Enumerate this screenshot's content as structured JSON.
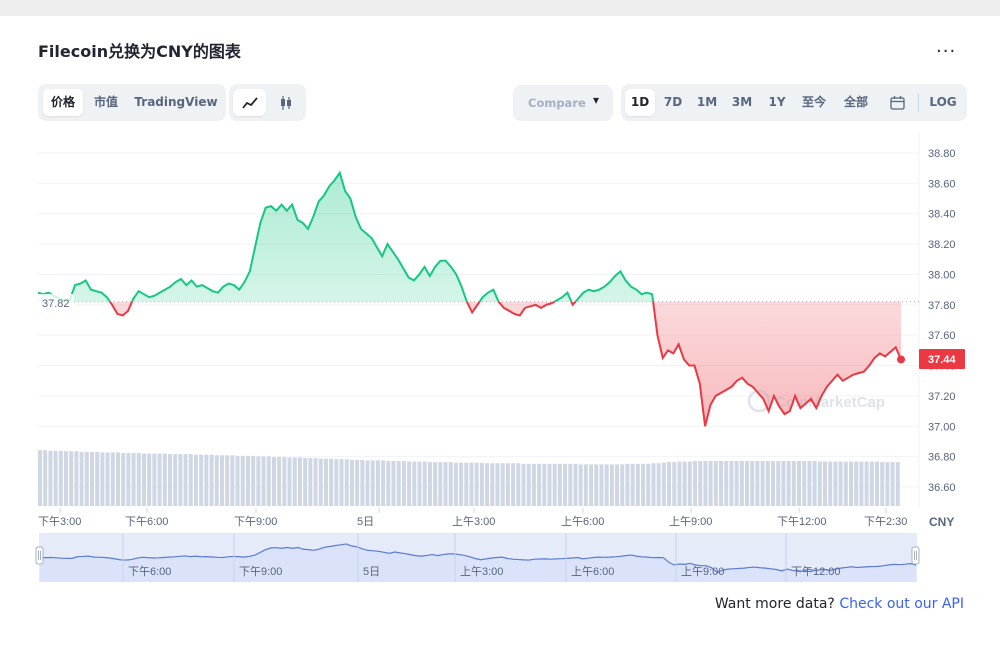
{
  "title": "Filecoin兑换为CNY的图表",
  "more_label": "...",
  "view_tabs": [
    "价格",
    "市值",
    "TradingView"
  ],
  "chart_types": [
    "line-chart-icon",
    "candlestick-icon"
  ],
  "compare_label": "Compare with",
  "ranges": [
    "1D",
    "7D",
    "1M",
    "3M",
    "1Y",
    "至今",
    "全部"
  ],
  "log_label": "LOG",
  "currency": "CNY",
  "watermark": "CoinMarketCap",
  "footer": {
    "text": "Want more data?",
    "link": "Check out our API"
  },
  "colors": {
    "up": "#16c784",
    "down": "#ea3943",
    "brand": "#3861fb"
  },
  "chart_data": {
    "type": "line",
    "reference_price": 37.82,
    "current_price": 37.44,
    "y_ticks": [
      "38.80",
      "38.60",
      "38.40",
      "38.20",
      "38.00",
      "37.80",
      "37.60",
      "37.40",
      "37.20",
      "37.00",
      "36.80",
      "36.60"
    ],
    "ylim": [
      36.5,
      38.9
    ],
    "x_ticks": [
      "下午3:00",
      "下午6:00",
      "下午9:00",
      "5日",
      "上午3:00",
      "上午6:00",
      "上午9:00",
      "下午12:00",
      "下午2:30"
    ],
    "navigator_ticks": [
      "下午6:00",
      "下午9:00",
      "5日",
      "上午3:00",
      "上午6:00",
      "上午9:00",
      "下午12:00"
    ],
    "values": [
      37.88,
      37.87,
      37.88,
      37.86,
      37.84,
      37.83,
      37.83,
      37.93,
      37.94,
      37.96,
      37.9,
      37.89,
      37.88,
      37.85,
      37.8,
      37.74,
      37.73,
      37.76,
      37.84,
      37.89,
      37.87,
      37.85,
      37.86,
      37.88,
      37.9,
      37.92,
      37.95,
      37.97,
      37.93,
      37.96,
      37.92,
      37.93,
      37.91,
      37.89,
      37.88,
      37.92,
      37.94,
      37.93,
      37.9,
      37.95,
      38.02,
      38.18,
      38.34,
      38.44,
      38.45,
      38.42,
      38.46,
      38.42,
      38.46,
      38.36,
      38.34,
      38.3,
      38.38,
      38.48,
      38.52,
      38.58,
      38.62,
      38.67,
      38.55,
      38.5,
      38.38,
      38.3,
      38.27,
      38.24,
      38.18,
      38.12,
      38.2,
      38.15,
      38.1,
      38.04,
      37.98,
      37.96,
      38.0,
      38.05,
      37.99,
      38.05,
      38.09,
      38.09,
      38.05,
      38.0,
      37.92,
      37.82,
      37.75,
      37.8,
      37.85,
      37.88,
      37.9,
      37.82,
      37.78,
      37.76,
      37.74,
      37.73,
      37.78,
      37.79,
      37.8,
      37.78,
      37.8,
      37.81,
      37.83,
      37.85,
      37.88,
      37.8,
      37.84,
      37.88,
      37.9,
      37.89,
      37.9,
      37.92,
      37.95,
      37.99,
      38.02,
      37.96,
      37.92,
      37.9,
      37.87,
      37.88,
      37.87,
      37.6,
      37.45,
      37.5,
      37.48,
      37.54,
      37.44,
      37.4,
      37.4,
      37.28,
      37.0,
      37.14,
      37.2,
      37.22,
      37.24,
      37.26,
      37.3,
      37.32,
      37.28,
      37.26,
      37.22,
      37.18,
      37.1,
      37.2,
      37.13,
      37.08,
      37.1,
      37.2,
      37.12,
      37.15,
      37.18,
      37.12,
      37.2,
      37.26,
      37.3,
      37.34,
      37.3,
      37.32,
      37.34,
      37.35,
      37.36,
      37.4,
      37.45,
      37.48,
      37.46,
      37.49,
      37.52,
      37.44
    ],
    "volume": [
      0.98,
      0.98,
      0.97,
      0.97,
      0.97,
      0.96,
      0.96,
      0.96,
      0.95,
      0.95,
      0.95,
      0.95,
      0.94,
      0.94,
      0.94,
      0.94,
      0.93,
      0.93,
      0.93,
      0.93,
      0.92,
      0.92,
      0.92,
      0.92,
      0.92,
      0.91,
      0.91,
      0.91,
      0.91,
      0.91,
      0.9,
      0.9,
      0.9,
      0.9,
      0.89,
      0.89,
      0.89,
      0.89,
      0.88,
      0.88,
      0.88,
      0.88,
      0.87,
      0.87,
      0.87,
      0.86,
      0.86,
      0.86,
      0.85,
      0.85,
      0.85,
      0.84,
      0.84,
      0.84,
      0.83,
      0.83,
      0.83,
      0.82,
      0.82,
      0.82,
      0.81,
      0.81,
      0.81,
      0.8,
      0.8,
      0.8,
      0.8,
      0.79,
      0.79,
      0.79,
      0.79,
      0.78,
      0.78,
      0.78,
      0.78,
      0.77,
      0.77,
      0.77,
      0.77,
      0.77,
      0.76,
      0.76,
      0.76,
      0.76,
      0.76,
      0.76,
      0.75,
      0.75,
      0.75,
      0.75,
      0.75,
      0.75,
      0.75,
      0.74,
      0.74,
      0.74,
      0.74,
      0.74,
      0.74,
      0.74,
      0.74,
      0.74,
      0.74,
      0.74,
      0.73,
      0.73,
      0.73,
      0.73,
      0.73,
      0.73,
      0.73,
      0.73,
      0.73,
      0.74,
      0.74,
      0.74,
      0.74,
      0.74,
      0.75,
      0.75,
      0.76,
      0.77,
      0.77,
      0.78,
      0.78,
      0.78,
      0.79,
      0.79,
      0.79,
      0.79,
      0.79,
      0.79,
      0.79,
      0.79,
      0.79,
      0.79,
      0.79,
      0.79,
      0.79,
      0.79,
      0.79,
      0.79,
      0.79,
      0.79,
      0.79,
      0.79,
      0.79,
      0.79,
      0.79,
      0.79,
      0.78,
      0.78,
      0.78,
      0.78,
      0.78,
      0.78,
      0.78,
      0.78,
      0.78,
      0.78,
      0.78,
      0.78,
      0.77,
      0.77,
      0.77,
      0.77
    ]
  }
}
